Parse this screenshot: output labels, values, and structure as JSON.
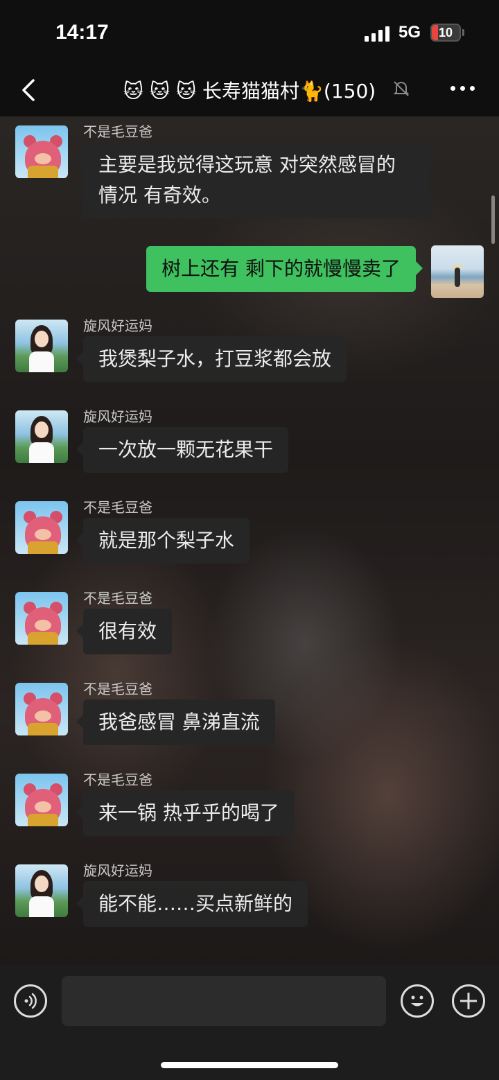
{
  "status_bar": {
    "time": "14:17",
    "network": "5G",
    "battery": "10"
  },
  "header": {
    "title": "🐱 🐱 🐱 长寿猫猫村🐈(150)"
  },
  "messages": [
    {
      "sender": "不是毛豆爸",
      "text": "主要是我觉得这玩意 对突然感冒的情况 有奇效。",
      "direction": "in"
    },
    {
      "sender": "",
      "text": "树上还有 剩下的就慢慢卖了",
      "direction": "out"
    },
    {
      "sender": "旋风好运妈",
      "text": "我煲梨子水，打豆浆都会放",
      "direction": "in"
    },
    {
      "sender": "旋风好运妈",
      "text": "一次放一颗无花果干",
      "direction": "in"
    },
    {
      "sender": "不是毛豆爸",
      "text": "就是那个梨子水",
      "direction": "in"
    },
    {
      "sender": "不是毛豆爸",
      "text": "很有效",
      "direction": "in"
    },
    {
      "sender": "不是毛豆爸",
      "text": "我爸感冒 鼻涕直流",
      "direction": "in"
    },
    {
      "sender": "不是毛豆爸",
      "text": "来一锅 热乎乎的喝了",
      "direction": "in"
    },
    {
      "sender": "旋风好运妈",
      "text": "能不能……买点新鲜的",
      "direction": "in"
    }
  ],
  "input": {
    "value": "",
    "placeholder": ""
  }
}
